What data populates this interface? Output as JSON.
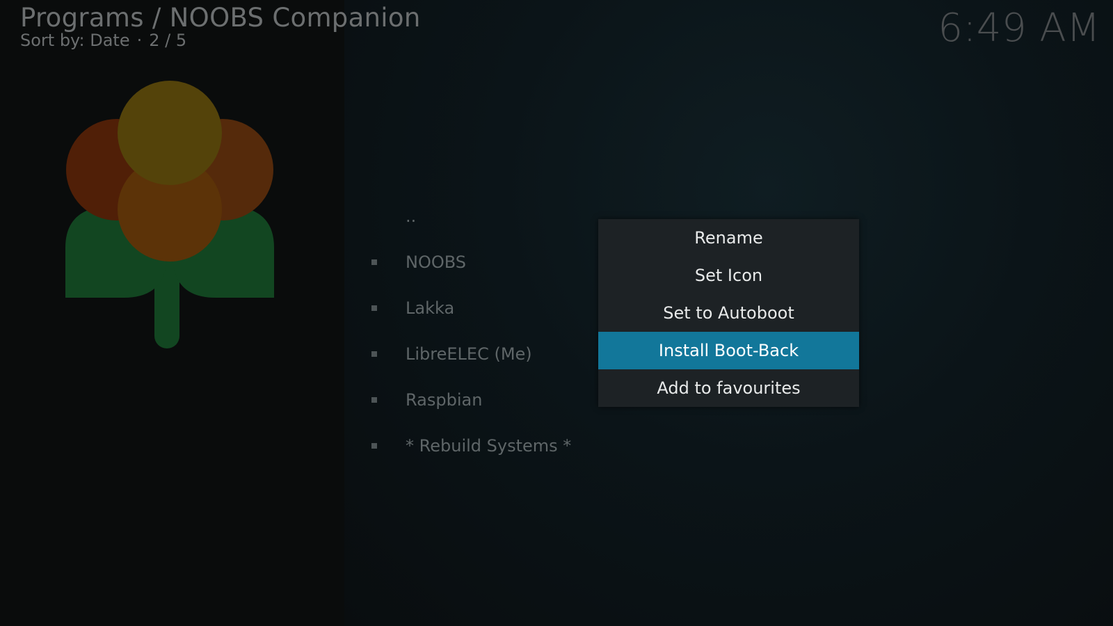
{
  "header": {
    "title": "Programs / NOOBS Companion",
    "sort_label": "Sort by: Date",
    "separator": "·",
    "position": "2 / 5"
  },
  "clock": "6:49 AM",
  "logo": {
    "icon": "noobs-raspberry-flower-icon"
  },
  "file_list": {
    "parent": "..",
    "items": [
      {
        "label": "NOOBS"
      },
      {
        "label": "Lakka"
      },
      {
        "label": "LibreELEC (Me)"
      },
      {
        "label": "Raspbian"
      },
      {
        "label": "* Rebuild Systems *"
      }
    ]
  },
  "context_menu": {
    "items": [
      {
        "label": "Rename"
      },
      {
        "label": "Set Icon"
      },
      {
        "label": "Set to Autoboot"
      },
      {
        "label": "Install Boot-Back",
        "focused": true
      },
      {
        "label": "Add to favourites"
      }
    ],
    "focus_color": "#12779a"
  }
}
